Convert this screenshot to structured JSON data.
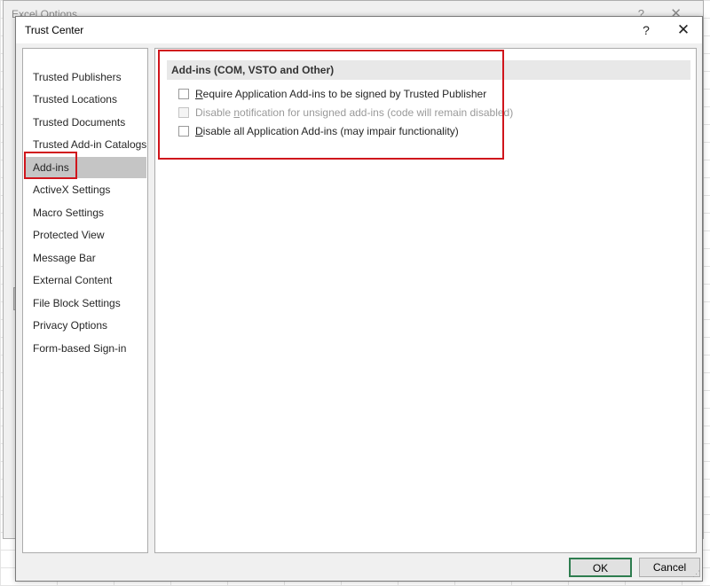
{
  "background_dialog": {
    "title": "Excel Options",
    "help_label": "?",
    "close_label": "✕"
  },
  "dialog": {
    "title": "Trust Center",
    "help_label": "?",
    "close_label": "✕"
  },
  "nav": {
    "selected": "Add-ins",
    "items": [
      {
        "label": "Trusted Publishers"
      },
      {
        "label": "Trusted Locations"
      },
      {
        "label": "Trusted Documents"
      },
      {
        "label": "Trusted Add-in Catalogs"
      },
      {
        "label": "Add-ins"
      },
      {
        "label": "ActiveX Settings"
      },
      {
        "label": "Macro Settings"
      },
      {
        "label": "Protected View"
      },
      {
        "label": "Message Bar"
      },
      {
        "label": "External Content"
      },
      {
        "label": "File Block Settings"
      },
      {
        "label": "Privacy Options"
      },
      {
        "label": "Form-based Sign-in"
      }
    ]
  },
  "content": {
    "section_title": "Add-ins (COM, VSTO and Other)",
    "options": [
      {
        "label": "Require Application Add-ins to be signed by Trusted Publisher",
        "accel": "R",
        "checked": false,
        "enabled": true
      },
      {
        "label": "Disable notification for unsigned add-ins (code will remain disabled)",
        "accel": "n",
        "checked": false,
        "enabled": false
      },
      {
        "label": "Disable all Application Add-ins (may impair functionality)",
        "accel": "D",
        "checked": false,
        "enabled": true
      }
    ]
  },
  "footer": {
    "ok_label": "OK",
    "cancel_label": "Cancel"
  },
  "colors": {
    "highlight": "#d0151c",
    "selected_nav": "#c5c5c5",
    "ok_border": "#2e7d4f"
  }
}
